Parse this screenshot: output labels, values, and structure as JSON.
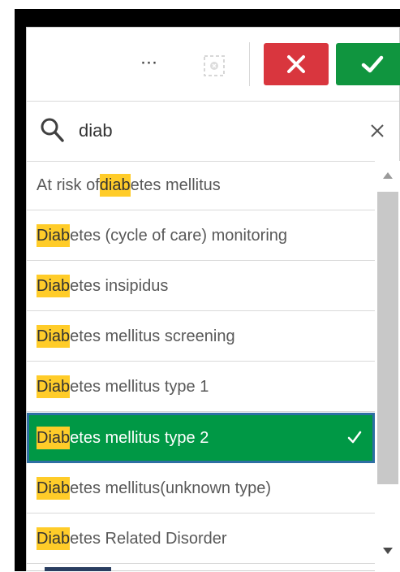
{
  "toolbar": {
    "more_label": "···",
    "clear_selection_icon": "clear-selection-icon",
    "cancel_icon": "close-icon",
    "confirm_icon": "check-icon",
    "colors": {
      "cancel": "#d9363e",
      "confirm": "#10953f"
    }
  },
  "search": {
    "value": "diab",
    "icon": "search-icon",
    "clear_icon": "close-icon"
  },
  "list": {
    "items": [
      {
        "pre": "At risk of ",
        "match": "diab",
        "post": "etes mellitus",
        "selected": false
      },
      {
        "pre": "",
        "match": "Diab",
        "post": "etes (cycle of care) monitoring",
        "selected": false
      },
      {
        "pre": "",
        "match": "Diab",
        "post": "etes insipidus",
        "selected": false
      },
      {
        "pre": "",
        "match": "Diab",
        "post": "etes mellitus screening",
        "selected": false
      },
      {
        "pre": "",
        "match": "Diab",
        "post": "etes mellitus type 1",
        "selected": false
      },
      {
        "pre": "",
        "match": "Diab",
        "post": "etes mellitus type 2",
        "selected": true
      },
      {
        "pre": "",
        "match": "Diab",
        "post": "etes mellitus(unknown type)",
        "selected": false
      },
      {
        "pre": "",
        "match": "Diab",
        "post": "etes Related Disorder",
        "selected": false
      }
    ],
    "highlight_color": "#ffcc29",
    "selected_color": "#009845"
  }
}
